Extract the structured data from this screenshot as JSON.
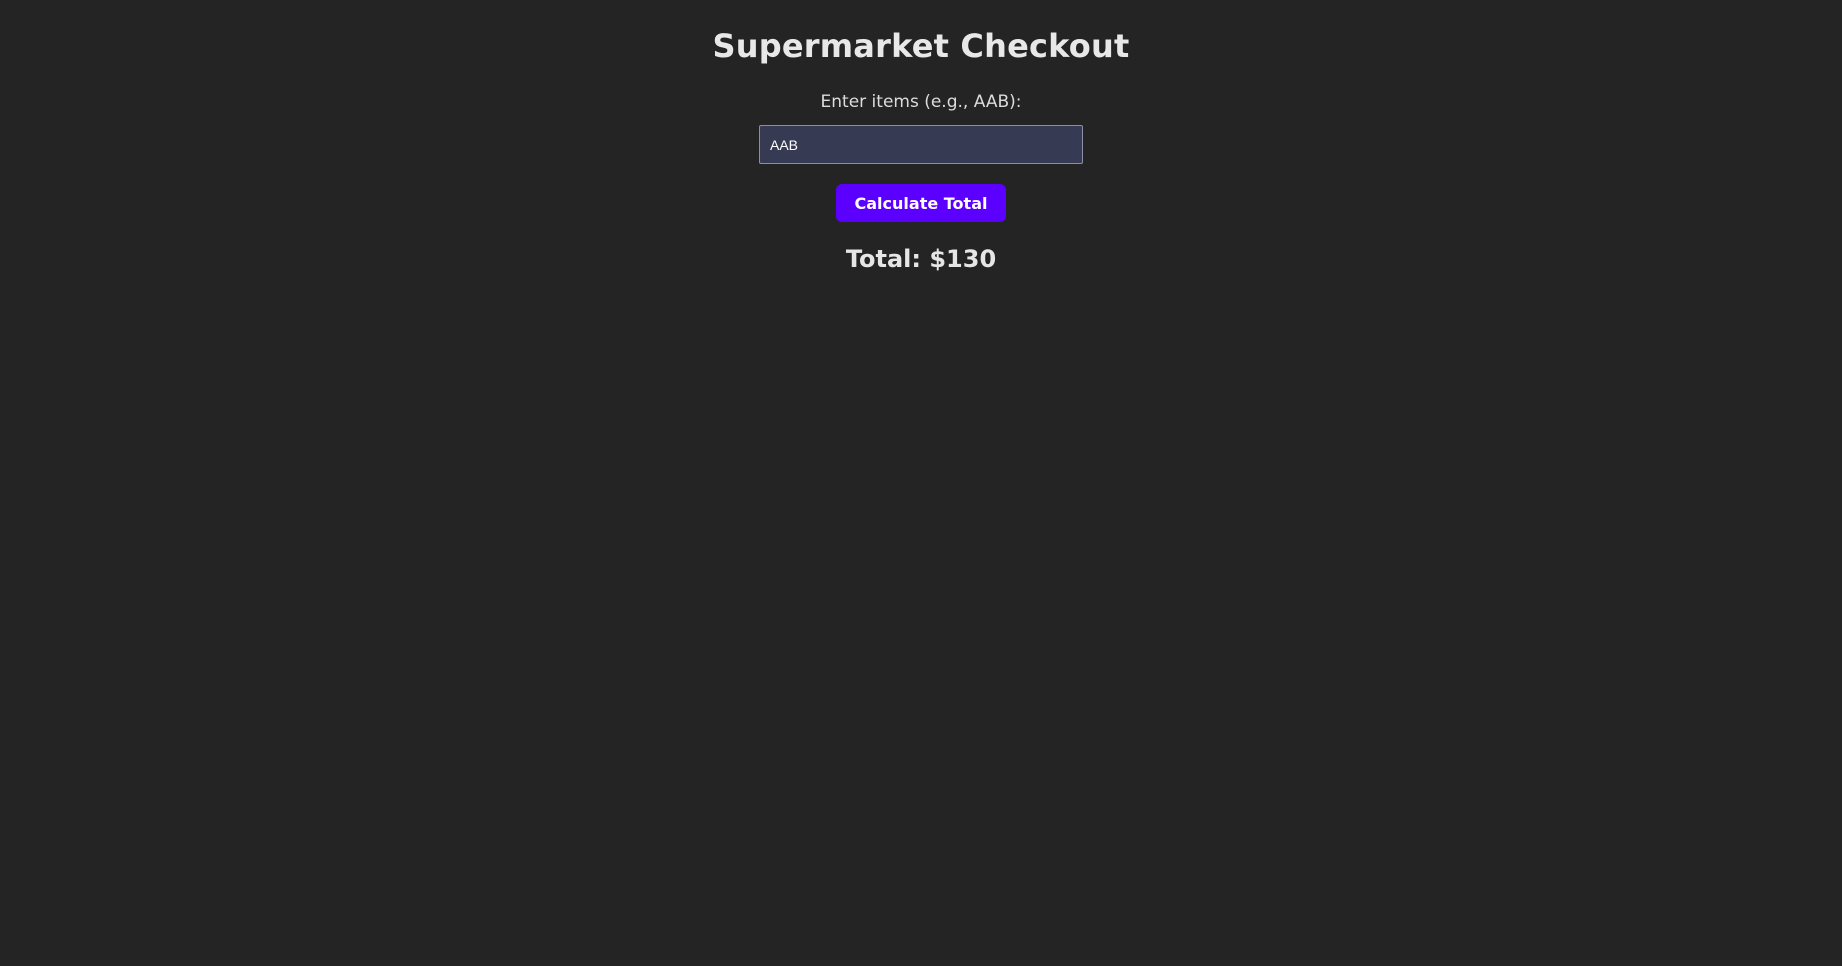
{
  "page": {
    "title": "Supermarket Checkout"
  },
  "form": {
    "items_label": "Enter items (e.g., AAB):",
    "items_value": "AAB",
    "calculate_label": "Calculate Total"
  },
  "result": {
    "total_text": "Total: $130"
  },
  "colors": {
    "background": "#242424",
    "input_background": "#363a53",
    "button_accent": "#5b00ff",
    "text": "#e6e6e6"
  }
}
